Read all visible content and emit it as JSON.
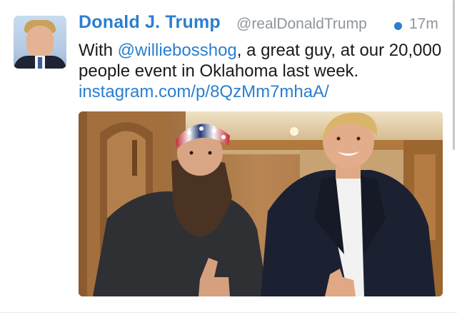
{
  "tweet": {
    "author_name": "Donald J. Trump",
    "author_handle": "@realDonaldTrump",
    "timestamp": "17m",
    "text_part_1": "With ",
    "mention": "@williebosshog",
    "text_part_2": ", a great guy, at our 20,000 people event in Oklahoma last week. ",
    "link": "instagram.com/p/8QzMm7mhaA/"
  },
  "colors": {
    "link": "#2a7fd0",
    "meta_text": "#8e959d",
    "body_text": "#1a1a1a"
  },
  "icons": {
    "unread": "unread-dot-icon"
  }
}
